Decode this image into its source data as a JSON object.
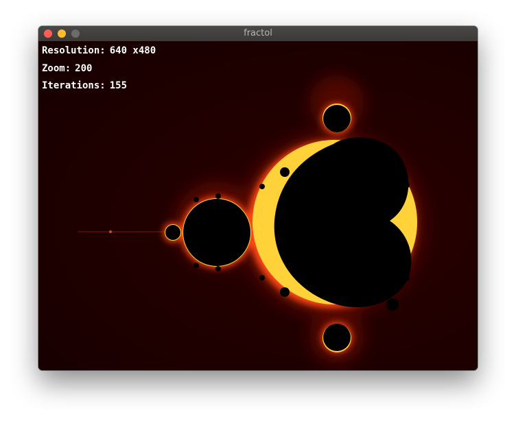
{
  "window": {
    "title": "fractol"
  },
  "hud": {
    "resolution_label": "Resolution:",
    "resolution_value": "640 x480",
    "zoom_label": "Zoom:",
    "zoom_value": "200",
    "iterations_label": "Iterations:",
    "iterations_value": "155"
  },
  "fractal": {
    "type": "Mandelbrot set",
    "colors": {
      "background": "#1c0000",
      "set": "#000000",
      "boundary_glow": "#ff3a10",
      "boundary_bright": "#ffd23a"
    }
  },
  "icons": {
    "close": "close-button-icon",
    "minimize": "minimize-button-icon",
    "maximize": "maximize-button-icon"
  }
}
